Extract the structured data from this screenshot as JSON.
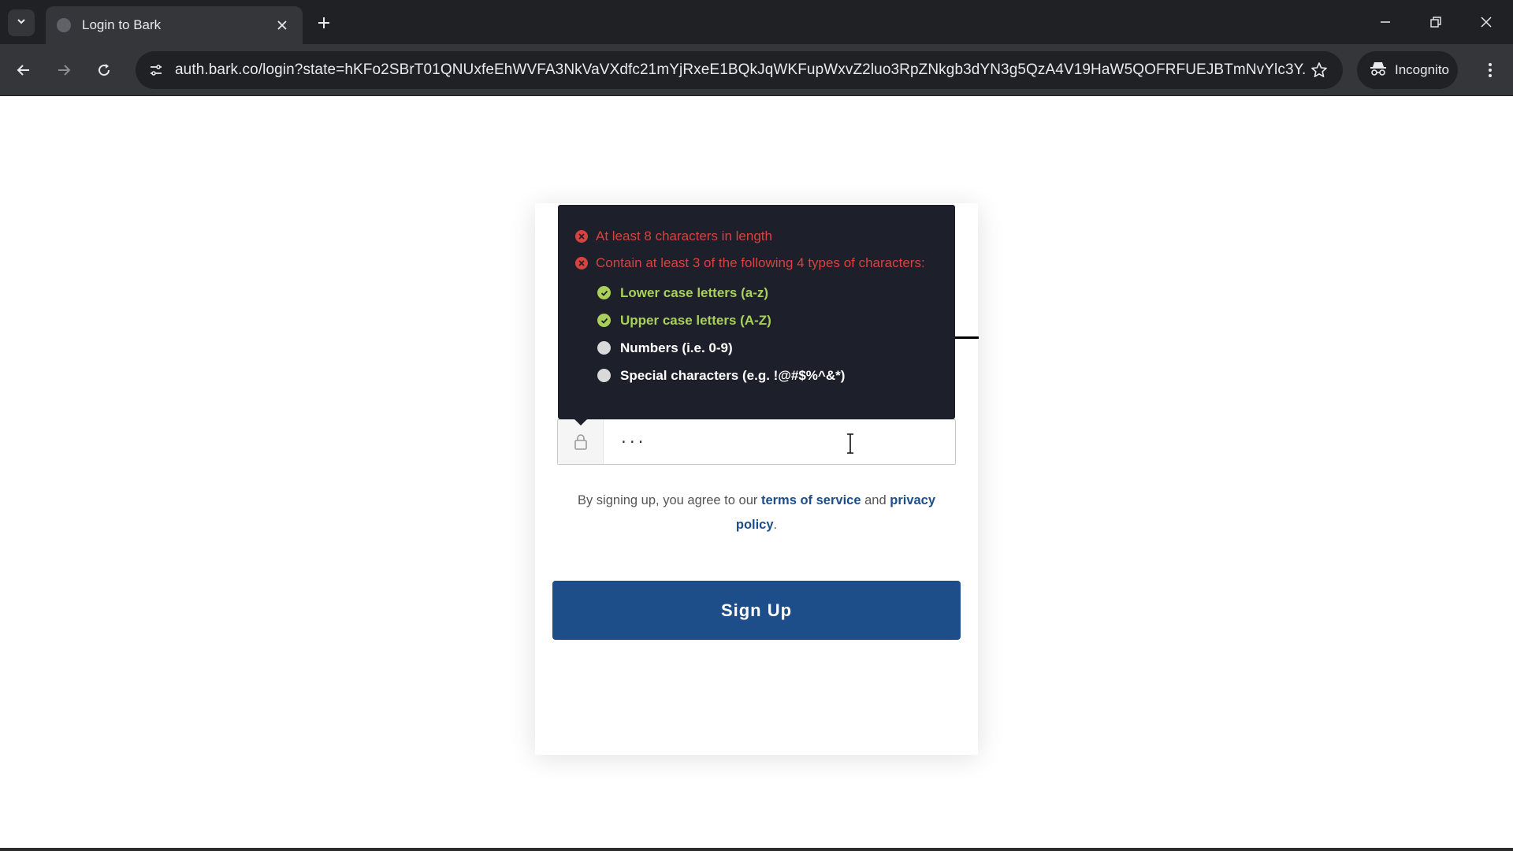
{
  "browser": {
    "tab": {
      "title": "Login to Bark"
    },
    "address_bar": {
      "url": "auth.bark.co/login?state=hKFo2SBrT01QNUxfeEhWVFA3NkVaVXdfc21mYjRxeE1BQkJqWKFupWxvZ2luo3RpZNkgb3dYN3g5QzA4V19HaW5QOFRFUEJBTmNvYlc3Y..."
    },
    "incognito_label": "Incognito"
  },
  "password_tooltip": {
    "rules": [
      {
        "text": "At least 8 characters in length",
        "status": "fail"
      },
      {
        "text": "Contain at least 3 of the following 4 types of characters:",
        "status": "fail"
      }
    ],
    "sub_rules": [
      {
        "text": "Lower case letters (a-z)",
        "status": "pass"
      },
      {
        "text": "Upper case letters (A-Z)",
        "status": "pass"
      },
      {
        "text": "Numbers (i.e. 0-9)",
        "status": "pending"
      },
      {
        "text": "Special characters (e.g. !@#$%^&*)",
        "status": "pending"
      }
    ]
  },
  "password_field": {
    "value": "···"
  },
  "legal": {
    "prefix": "By signing up, you agree to our ",
    "terms_link": "terms of service",
    "middle": " and ",
    "privacy_link": "privacy policy",
    "suffix": "."
  },
  "signup_button": {
    "label": "Sign Up"
  },
  "colors": {
    "primary": "#1d4e89",
    "error": "#d7433e",
    "success": "#a8d05a",
    "tooltip_bg": "#1d1f2b"
  }
}
